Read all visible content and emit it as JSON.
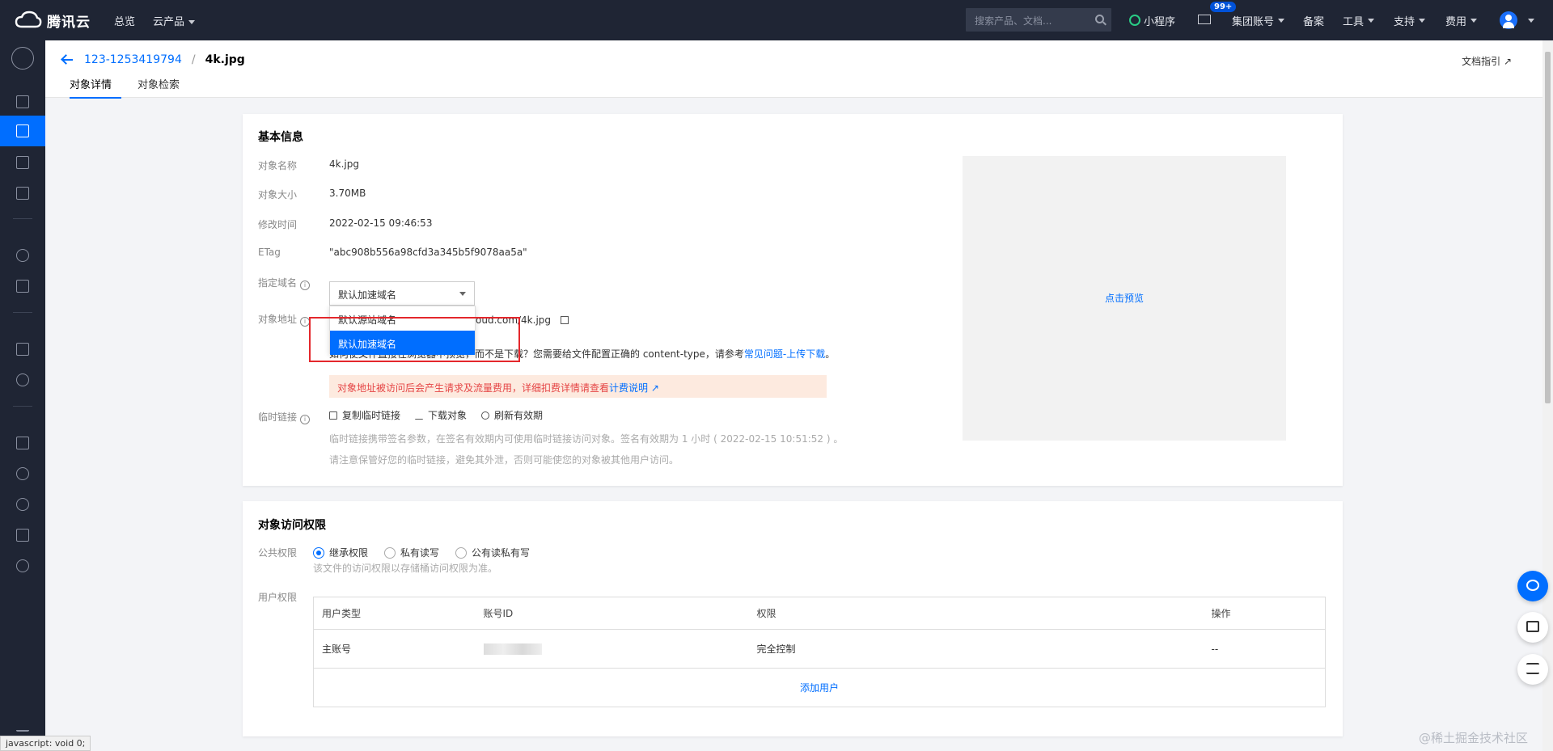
{
  "topbar": {
    "brand": "腾讯云",
    "nav": [
      "总览",
      "云产品"
    ],
    "search_placeholder": "搜索产品、文档...",
    "mini_program": "小程序",
    "msg_badge": "99+",
    "group_account": "集团账号",
    "beian": "备案",
    "tools": "工具",
    "support": "支持",
    "fees": "费用"
  },
  "breadcrumb": {
    "bucket": "123-1253419794",
    "separator": "/",
    "object": "4k.jpg"
  },
  "doc_link": "文档指引",
  "tabs": [
    "对象详情",
    "对象检索"
  ],
  "basic_info": {
    "title": "基本信息",
    "rows": [
      {
        "label": "对象名称",
        "value": "4k.jpg"
      },
      {
        "label": "对象大小",
        "value": "3.70MB"
      },
      {
        "label": "修改时间",
        "value": "2022-02-15 09:46:53"
      },
      {
        "label": "ETag",
        "value": "\"abc908b556a98cfd3a345b5f9078aa5a\""
      }
    ],
    "domain_label": "指定域名",
    "domain_selected": "默认加速域名",
    "domain_options": [
      "默认源站域名",
      "默认加速域名"
    ],
    "address_label": "对象地址",
    "address_value": "oud.com/4k.jpg",
    "preview_hint_prefix": "如何使文件直接在浏览器中预览，而不是下载？您需要给文件配置正确的 content-type，请参考",
    "preview_hint_link": "常见问题-上传下载",
    "preview_hint_suffix": "。",
    "warn_text": "对象地址被访问后会产生请求及流量费用，详细扣费详情请查看",
    "warn_link": "计费说明",
    "temp_link_label": "临时链接",
    "actions": [
      "复制临时链接",
      "下载对象",
      "刷新有效期"
    ],
    "temp_hint1": "临时链接携带签名参数，在签名有效期内可使用临时链接访问对象。签名有效期为 1 小时 ( 2022-02-15 10:51:52 ) 。",
    "temp_hint2": "请注意保管好您的临时链接，避免其外泄，否则可能使您的对象被其他用户访问。",
    "preview_button": "点击预览"
  },
  "access": {
    "title": "对象访问权限",
    "public_label": "公共权限",
    "radios": [
      {
        "label": "继承权限",
        "selected": true
      },
      {
        "label": "私有读写",
        "selected": false
      },
      {
        "label": "公有读私有写",
        "selected": false
      }
    ],
    "public_hint": "该文件的访问权限以存储桶访问权限为准。",
    "user_label": "用户权限",
    "table": {
      "headers": [
        "用户类型",
        "账号ID",
        "权限",
        "操作"
      ],
      "rows": [
        {
          "type": "主账号",
          "id": "",
          "perm": "完全控制",
          "op": "--"
        }
      ],
      "add_user": "添加用户"
    }
  },
  "status_tip": "javascript: void 0;",
  "watermark": "@稀土掘金技术社区"
}
